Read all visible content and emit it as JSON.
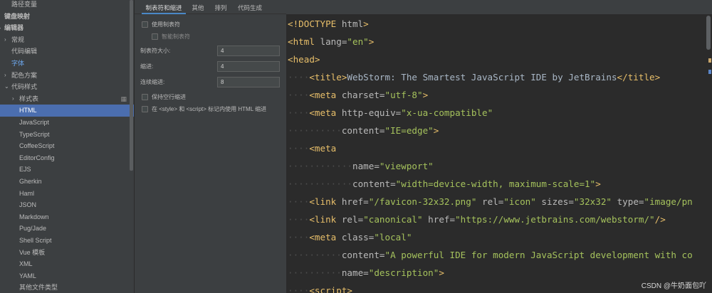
{
  "tree": {
    "items": [
      {
        "label": "路径变量",
        "indent": 16,
        "arrow": "",
        "bold": false,
        "selected": false,
        "accent": false
      },
      {
        "label": "键盘映射",
        "indent": 6,
        "arrow": "",
        "bold": true,
        "selected": false,
        "accent": false
      },
      {
        "label": "编辑器",
        "indent": 6,
        "arrow": "down",
        "bold": true,
        "selected": false,
        "accent": false
      },
      {
        "label": "常规",
        "indent": 16,
        "arrow": "right",
        "bold": false,
        "selected": false,
        "accent": false
      },
      {
        "label": "代码编辑",
        "indent": 16,
        "arrow": "",
        "bold": false,
        "selected": false,
        "accent": false
      },
      {
        "label": "字体",
        "indent": 16,
        "arrow": "",
        "bold": false,
        "selected": false,
        "accent": true
      },
      {
        "label": "配色方案",
        "indent": 16,
        "arrow": "right",
        "bold": false,
        "selected": false,
        "accent": false
      },
      {
        "label": "代码样式",
        "indent": 16,
        "arrow": "down",
        "bold": false,
        "selected": false,
        "accent": false
      },
      {
        "label": "样式表",
        "indent": 27,
        "arrow": "right",
        "bold": false,
        "selected": false,
        "accent": false,
        "gear": true
      },
      {
        "label": "HTML",
        "indent": 27,
        "arrow": "",
        "bold": false,
        "selected": true,
        "accent": false
      },
      {
        "label": "JavaScript",
        "indent": 27,
        "arrow": "",
        "bold": false,
        "selected": false,
        "accent": false
      },
      {
        "label": "TypeScript",
        "indent": 27,
        "arrow": "",
        "bold": false,
        "selected": false,
        "accent": false
      },
      {
        "label": "CoffeeScript",
        "indent": 27,
        "arrow": "",
        "bold": false,
        "selected": false,
        "accent": false
      },
      {
        "label": "EditorConfig",
        "indent": 27,
        "arrow": "",
        "bold": false,
        "selected": false,
        "accent": false
      },
      {
        "label": "EJS",
        "indent": 27,
        "arrow": "",
        "bold": false,
        "selected": false,
        "accent": false
      },
      {
        "label": "Gherkin",
        "indent": 27,
        "arrow": "",
        "bold": false,
        "selected": false,
        "accent": false
      },
      {
        "label": "Haml",
        "indent": 27,
        "arrow": "",
        "bold": false,
        "selected": false,
        "accent": false
      },
      {
        "label": "JSON",
        "indent": 27,
        "arrow": "",
        "bold": false,
        "selected": false,
        "accent": false
      },
      {
        "label": "Markdown",
        "indent": 27,
        "arrow": "",
        "bold": false,
        "selected": false,
        "accent": false
      },
      {
        "label": "Pug/Jade",
        "indent": 27,
        "arrow": "",
        "bold": false,
        "selected": false,
        "accent": false
      },
      {
        "label": "Shell Script",
        "indent": 27,
        "arrow": "",
        "bold": false,
        "selected": false,
        "accent": false
      },
      {
        "label": "Vue 模板",
        "indent": 27,
        "arrow": "",
        "bold": false,
        "selected": false,
        "accent": false
      },
      {
        "label": "XML",
        "indent": 27,
        "arrow": "",
        "bold": false,
        "selected": false,
        "accent": false
      },
      {
        "label": "YAML",
        "indent": 27,
        "arrow": "",
        "bold": false,
        "selected": false,
        "accent": false
      },
      {
        "label": "其他文件类型",
        "indent": 27,
        "arrow": "",
        "bold": false,
        "selected": false,
        "accent": false
      }
    ]
  },
  "tabs": [
    {
      "label": "制表符和缩进",
      "active": true
    },
    {
      "label": "其他",
      "active": false
    },
    {
      "label": "排列",
      "active": false
    },
    {
      "label": "代码生成",
      "active": false
    }
  ],
  "options": {
    "use_tab": "使用制表符",
    "smart_tab": "智能制表符",
    "tab_size_label": "制表符大小:",
    "tab_size_value": "4",
    "indent_label": "缩进:",
    "indent_value": "4",
    "continuation_label": "连续缩进:",
    "continuation_value": "8",
    "keep_blank": "保持空行缩进",
    "html_indent": "在 <style> 和 <script> 标记内使用 HTML 缩进"
  },
  "code_lines": [
    [
      [
        "",
        "t",
        "<!DOCTYPE "
      ],
      [
        "",
        "a",
        "html"
      ],
      [
        "",
        "t",
        ">"
      ]
    ],
    [
      [
        "",
        "t",
        "<html "
      ],
      [
        "",
        "a",
        "lang="
      ],
      [
        "",
        "v",
        "\"en\""
      ],
      [
        "",
        "t",
        ">"
      ]
    ],
    [
      [
        "",
        "t",
        "<head>"
      ]
    ],
    [
      [
        "····",
        "t",
        "<title>"
      ],
      [
        "",
        "tx",
        "WebStorm: The Smartest JavaScript IDE by JetBrains"
      ],
      [
        "",
        "t",
        "</title>"
      ]
    ],
    [
      [
        "····",
        "t",
        "<meta "
      ],
      [
        "",
        "a",
        "charset="
      ],
      [
        "",
        "v",
        "\"utf-8\""
      ],
      [
        "",
        "t",
        ">"
      ]
    ],
    [
      [
        "····",
        "t",
        "<meta "
      ],
      [
        "",
        "a",
        "http-equiv="
      ],
      [
        "",
        "v",
        "\"x-ua-compatible\""
      ]
    ],
    [
      [
        "··········",
        "a",
        "content="
      ],
      [
        "",
        "v",
        "\"IE=edge\""
      ],
      [
        "",
        "t",
        ">"
      ]
    ],
    [
      [
        "····",
        "t",
        "<meta"
      ]
    ],
    [
      [
        "············",
        "a",
        "name="
      ],
      [
        "",
        "v",
        "\"viewport\""
      ]
    ],
    [
      [
        "············",
        "a",
        "content="
      ],
      [
        "",
        "v",
        "\"width=device-width, maximum-scale=1\""
      ],
      [
        "",
        "t",
        ">"
      ]
    ],
    [
      [
        "····",
        "t",
        "<link "
      ],
      [
        "",
        "a",
        "href="
      ],
      [
        "",
        "v",
        "\"/favicon-32x32.png\""
      ],
      [
        "",
        "a",
        " rel="
      ],
      [
        "",
        "v",
        "\"icon\""
      ],
      [
        "",
        "a",
        " sizes="
      ],
      [
        "",
        "v",
        "\"32x32\""
      ],
      [
        "",
        "a",
        " type="
      ],
      [
        "",
        "v",
        "\"image/pn"
      ]
    ],
    [
      [
        "····",
        "t",
        "<link "
      ],
      [
        "",
        "a",
        "rel="
      ],
      [
        "",
        "v",
        "\"canonical\""
      ],
      [
        "",
        "a",
        " href="
      ],
      [
        "",
        "v",
        "\"https://www.jetbrains.com/webstorm/\""
      ],
      [
        "",
        "t",
        "/>"
      ]
    ],
    [
      [
        "····",
        "t",
        "<meta "
      ],
      [
        "",
        "a",
        "class="
      ],
      [
        "",
        "v",
        "\"local\""
      ]
    ],
    [
      [
        "··········",
        "a",
        "content="
      ],
      [
        "",
        "v",
        "\"A powerful IDE for modern JavaScript development with co"
      ]
    ],
    [
      [
        "··········",
        "a",
        "name="
      ],
      [
        "",
        "v",
        "\"description\""
      ],
      [
        "",
        "t",
        ">"
      ]
    ],
    [
      [
        "····",
        "t",
        "<script>"
      ]
    ]
  ],
  "watermark": "CSDN @牛奶面包吖"
}
